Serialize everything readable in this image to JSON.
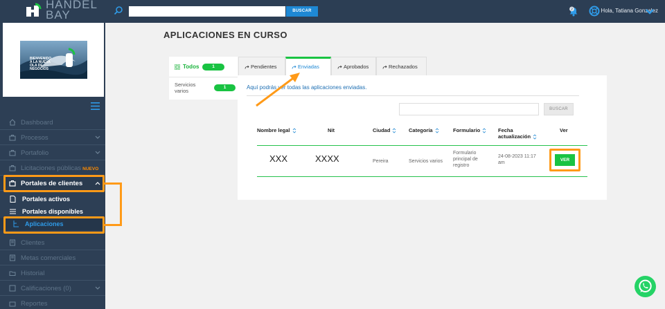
{
  "header": {
    "search_button": "BUSCAR",
    "search_placeholder": "",
    "notification_count": "2",
    "greeting": "Hola, Tatiana Gonzalez"
  },
  "brand": {
    "logo_line1": "HANDEL",
    "logo_line2": "BAY",
    "banner_text": [
      "BIENVENIDO",
      "A LA NUEVA",
      "OLA DE",
      "NEGOCIOS"
    ]
  },
  "sidebar": {
    "items": [
      {
        "label": "Dashboard",
        "icon": "home-icon"
      },
      {
        "label": "Procesos",
        "icon": "briefcase-icon",
        "has_chevron": true
      },
      {
        "label": "Portafolio",
        "icon": "portfolio-icon",
        "has_chevron": true
      },
      {
        "label": "Licitaciones públicas",
        "badge": "NUEVO",
        "icon": "gavel-icon"
      },
      {
        "label": "Portales de clientes",
        "icon": "briefcase-icon",
        "has_chevron": true,
        "active": true
      },
      {
        "label": "Clientes",
        "icon": "building-icon"
      },
      {
        "label": "Metas comerciales",
        "icon": "building-icon"
      },
      {
        "label": "Historial",
        "icon": "folder-icon"
      },
      {
        "label": "Calificaciones (0)",
        "icon": "square-icon",
        "has_chevron": true
      },
      {
        "label": "Reportes",
        "icon": "report-icon"
      }
    ],
    "sub_items": [
      {
        "label": "Portales activos",
        "icon": "document-icon"
      },
      {
        "label": "Portales disponibles",
        "icon": "list-icon"
      },
      {
        "label": "Aplicaciones",
        "icon": "tree-icon",
        "selected": true
      }
    ]
  },
  "main": {
    "title": "APLICACIONES EN CURSO",
    "filters": [
      {
        "label": "Todos",
        "count": "1",
        "active": true
      },
      {
        "label": "Servicios varios",
        "count": "1"
      }
    ],
    "tabs": [
      {
        "label": "Pendientes"
      },
      {
        "label": "Enviadas",
        "active": true
      },
      {
        "label": "Aprobados"
      },
      {
        "label": "Rechazados"
      }
    ],
    "description": "Aquí podrás ver todas las aplicaciones enviadas.",
    "search_button": "BUSCAR",
    "table": {
      "headers": [
        "Nombre legal",
        "Nit",
        "Ciudad",
        "Categoría",
        "Formulario",
        "Fecha actualización",
        "Ver"
      ],
      "rows": [
        {
          "nombre": "XXX",
          "nit": "XXXX",
          "ciudad": "Pereira",
          "categoria": "Servicios varios",
          "formulario": "Formulario principal de registro",
          "fecha": "24-08-2023 11:17 am",
          "ver": "VER"
        }
      ]
    }
  },
  "colors": {
    "sidebar_bg": "#2d3f55",
    "accent_green": "#19c342",
    "accent_blue": "#1e88d4",
    "highlight_orange": "#ff9a18"
  }
}
